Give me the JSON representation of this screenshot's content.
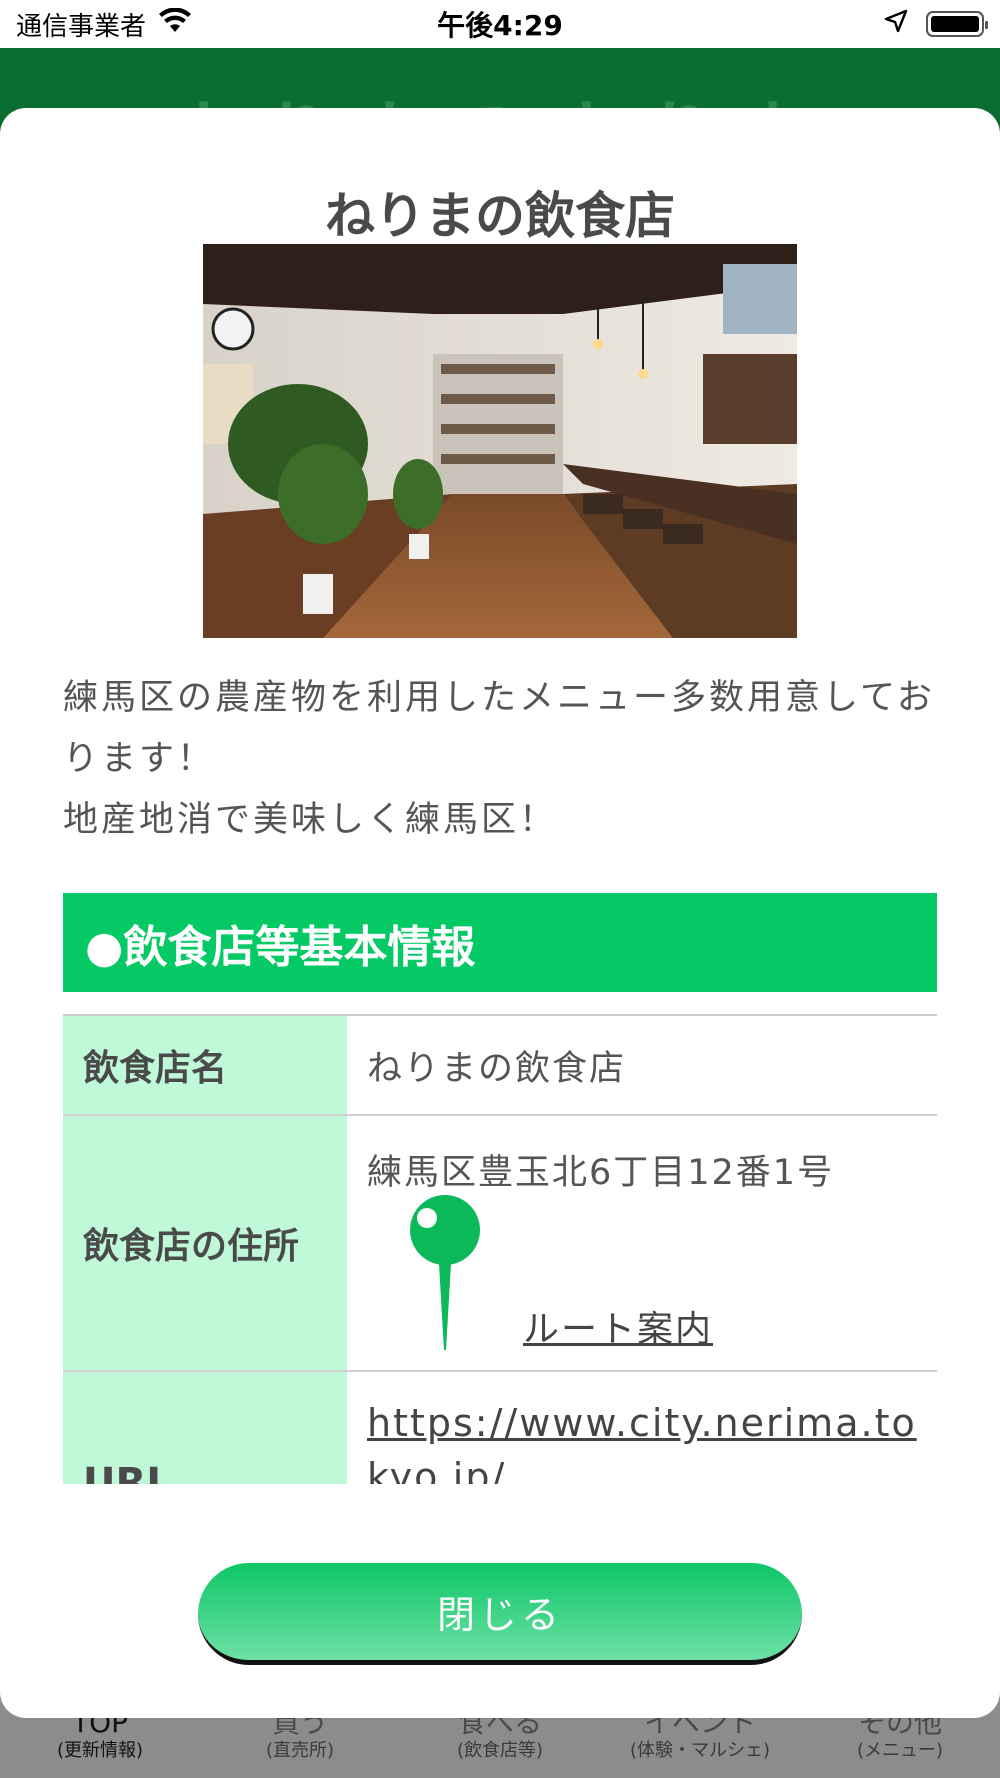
{
  "status_bar": {
    "carrier": "通信事業者",
    "time": "午後4:29",
    "battery_level": 1.0
  },
  "background": {
    "header_title": "ねりまで ねりま",
    "tabs": [
      {
        "label": "TOP",
        "sub": "(更新情報)",
        "active": true
      },
      {
        "label": "買う",
        "sub": "(直売所)",
        "active": false
      },
      {
        "label": "食べる",
        "sub": "(飲食店等)",
        "active": false
      },
      {
        "label": "イベント",
        "sub": "(体験・マルシェ)",
        "active": false
      },
      {
        "label": "その他",
        "sub": "(メニュー)",
        "active": false
      }
    ]
  },
  "modal": {
    "title": "ねりまの飲食店",
    "description_line1": "練馬区の農産物を利用したメニュー多数用意しております！",
    "description_line2": "地産地消で美味しく練馬区！",
    "section_header": "●飲食店等基本情報",
    "rows": {
      "name_label": "飲食店名",
      "name_value": "ねりまの飲食店",
      "address_label": "飲食店の住所",
      "address_value": "練馬区豊玉北6丁目12番1号",
      "route_link": "ルート案内",
      "url_label": "URL",
      "url_value": "https://www.city.nerima.tokyo.jp/"
    },
    "close_label": "閉じる"
  },
  "colors": {
    "header_green": "#0b6e31",
    "section_green": "#05c965",
    "label_mint": "#bff9d8",
    "pin_green": "#0cb95a"
  }
}
